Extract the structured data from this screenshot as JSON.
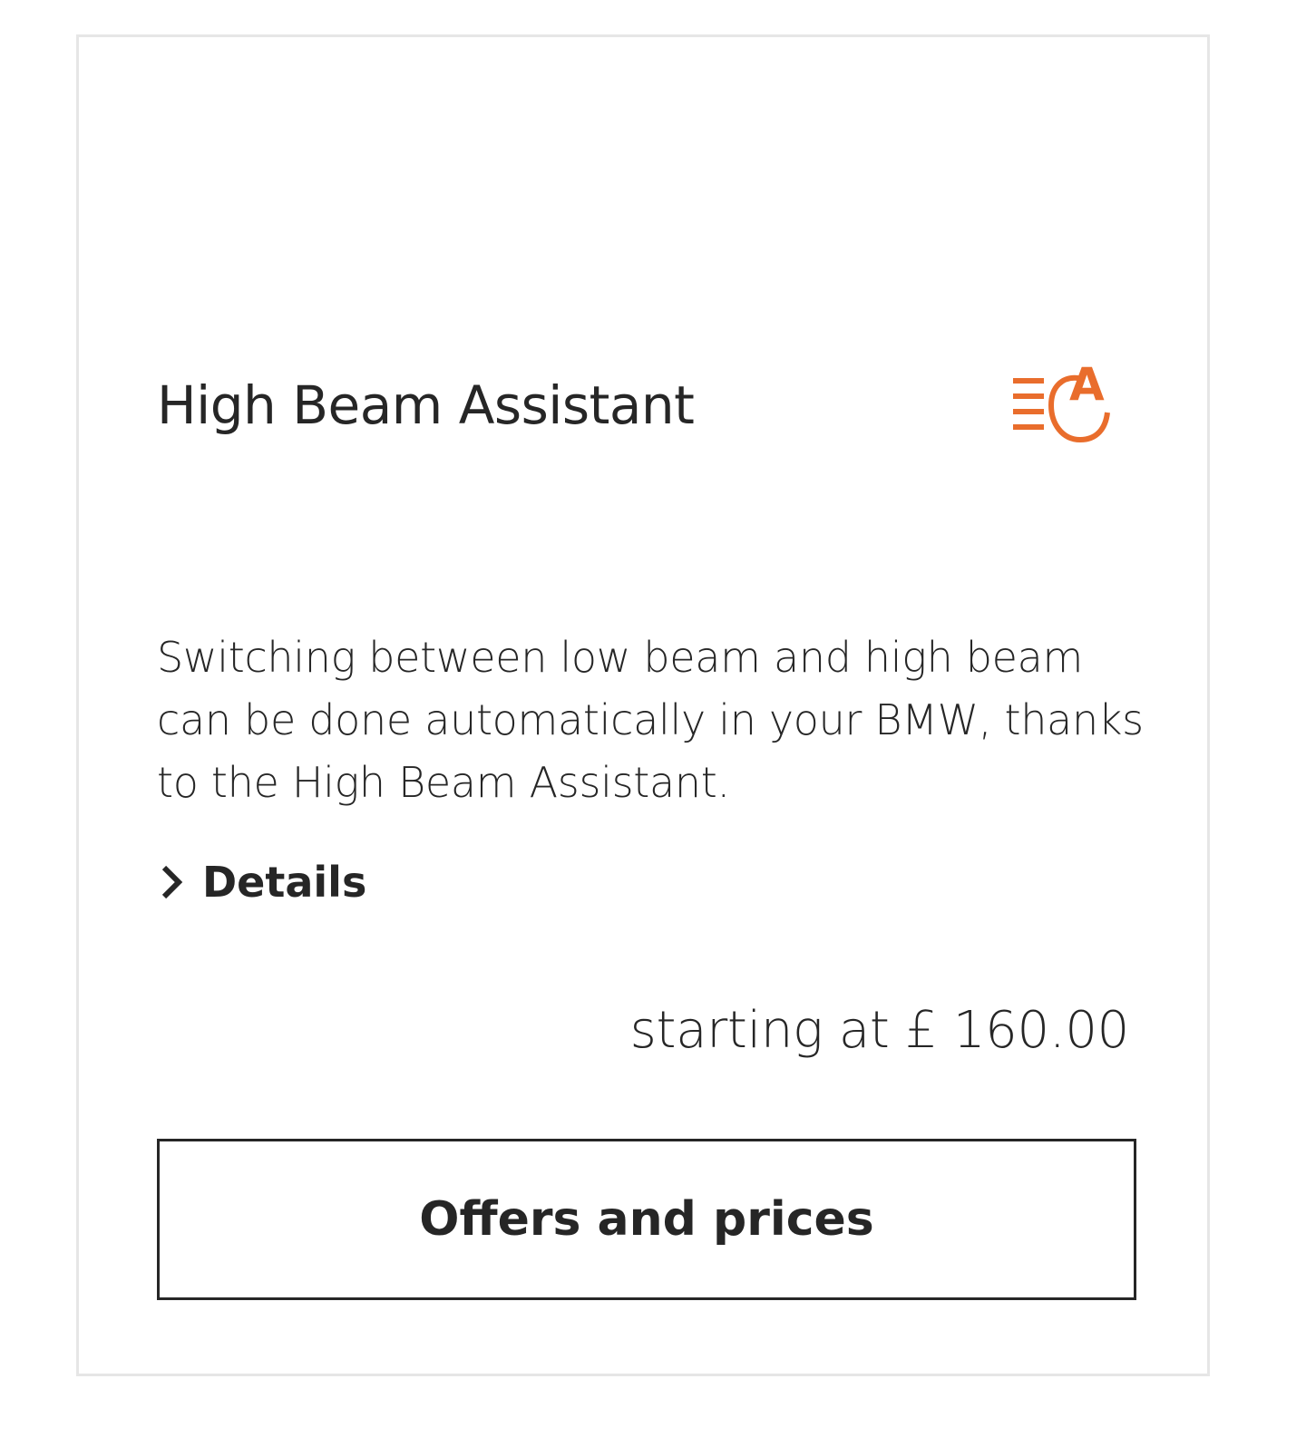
{
  "card": {
    "title": "High Beam Assistant",
    "icon": "high-beam-assistant-icon",
    "icon_color": "#e96d2c",
    "description": "Switching between low beam and high beam can be done automatically in your BMW, thanks to the High Beam Assistant.",
    "details_label": "Details",
    "price_text": "starting at £ 160.00",
    "button_label": "Offers and prices"
  }
}
